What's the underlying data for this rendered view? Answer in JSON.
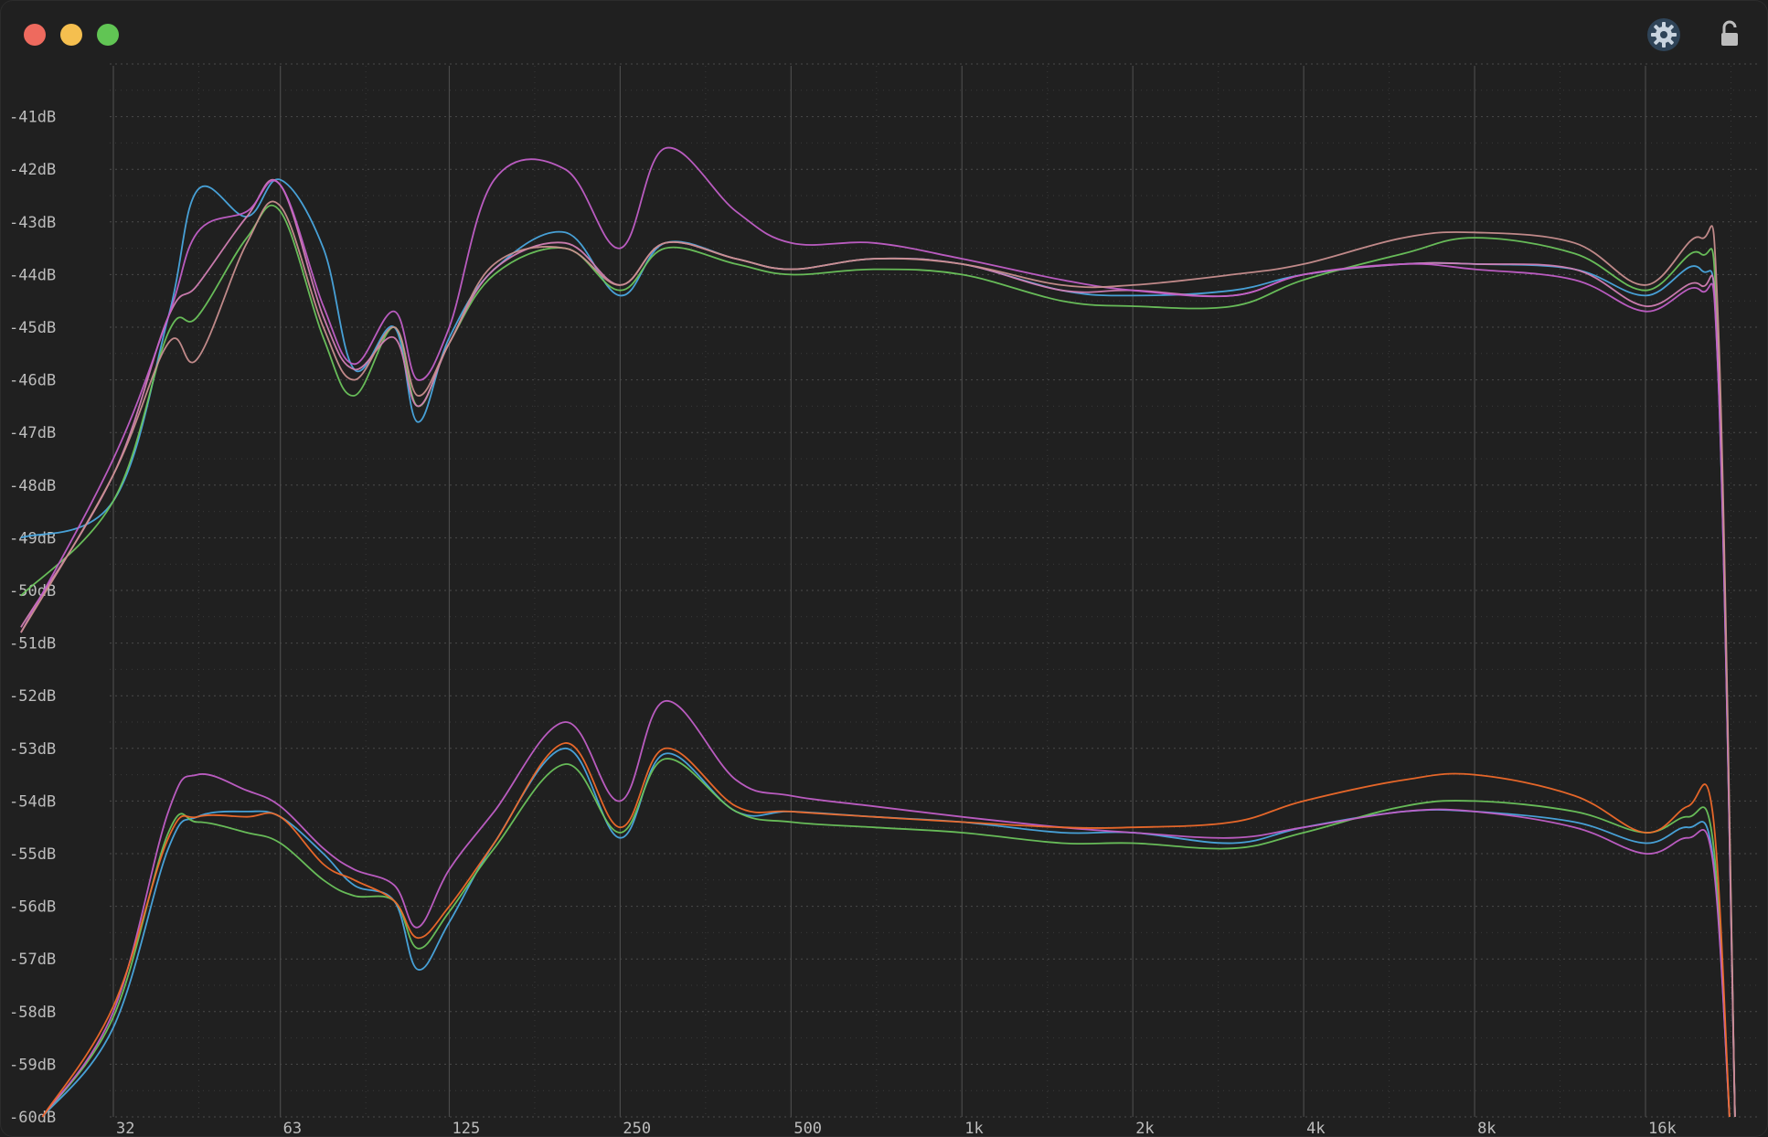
{
  "window": {
    "controls": [
      "close",
      "minimize",
      "maximize"
    ],
    "icons": [
      "gear-icon",
      "lock-icon"
    ]
  },
  "colors": {
    "background": "#202020",
    "grid_major": "#4a4a4a",
    "grid_minor": "#3a3a3a",
    "label": "#bdbdbd",
    "blue": "#4aa8e0",
    "green": "#6cc45c",
    "pink": "#d27fb4",
    "magenta": "#c25fc8",
    "rose": "#c98f8f",
    "orange": "#f06a2a"
  },
  "chart_data": {
    "type": "line",
    "title": "",
    "xlabel": "",
    "ylabel": "",
    "x_scale": "log",
    "xlim": [
      22,
      25000
    ],
    "ylim": [
      -60,
      -40
    ],
    "y_ticks": [
      "-41dB",
      "-42dB",
      "-43dB",
      "-44dB",
      "-45dB",
      "-46dB",
      "-47dB",
      "-48dB",
      "-49dB",
      "-50dB",
      "-51dB",
      "-52dB",
      "-53dB",
      "-54dB",
      "-55dB",
      "-56dB",
      "-57dB",
      "-58dB",
      "-59dB",
      "-60dB"
    ],
    "y_tick_values": [
      -41,
      -42,
      -43,
      -44,
      -45,
      -46,
      -47,
      -48,
      -49,
      -50,
      -51,
      -52,
      -53,
      -54,
      -55,
      -56,
      -57,
      -58,
      -59,
      -60
    ],
    "x_ticks": [
      "32",
      "63",
      "125",
      "250",
      "500",
      "1k",
      "2k",
      "4k",
      "8k",
      "16k"
    ],
    "x_tick_values": [
      32,
      63,
      125,
      250,
      500,
      1000,
      2000,
      4000,
      8000,
      16000
    ],
    "grid": true,
    "series": [
      {
        "group": "upper",
        "color": "#4aa8e0",
        "x": [
          22,
          32,
          40,
          45,
          55,
          63,
          75,
          85,
          100,
          110,
          125,
          150,
          200,
          250,
          300,
          400,
          500,
          700,
          1000,
          1500,
          2000,
          3000,
          4000,
          6000,
          8000,
          12000,
          16000,
          20000,
          21500,
          23000
        ],
        "y": [
          -49.0,
          -48.3,
          -44.8,
          -42.4,
          -42.9,
          -42.2,
          -43.5,
          -45.8,
          -45.0,
          -46.8,
          -45.2,
          -43.9,
          -43.2,
          -44.4,
          -43.4,
          -43.7,
          -43.9,
          -43.7,
          -43.8,
          -44.3,
          -44.4,
          -44.3,
          -44.0,
          -43.8,
          -43.8,
          -43.9,
          -44.4,
          -43.9,
          -46.0,
          -60.0
        ]
      },
      {
        "group": "upper",
        "color": "#6cc45c",
        "x": [
          22,
          32,
          40,
          45,
          55,
          63,
          75,
          85,
          100,
          110,
          125,
          150,
          200,
          250,
          300,
          400,
          500,
          700,
          1000,
          1500,
          2000,
          3000,
          4000,
          6000,
          8000,
          12000,
          16000,
          20000,
          21500,
          23000
        ],
        "y": [
          -50.1,
          -48.3,
          -45.1,
          -44.8,
          -43.3,
          -42.8,
          -45.2,
          -46.3,
          -45.0,
          -46.5,
          -45.3,
          -44.0,
          -43.5,
          -44.3,
          -43.5,
          -43.8,
          -44.0,
          -43.9,
          -44.0,
          -44.5,
          -44.6,
          -44.6,
          -44.1,
          -43.6,
          -43.3,
          -43.6,
          -44.3,
          -43.6,
          -45.5,
          -60.0
        ]
      },
      {
        "group": "upper",
        "color": "#d27fb4",
        "x": [
          22,
          32,
          40,
          45,
          55,
          63,
          75,
          85,
          100,
          110,
          125,
          150,
          200,
          250,
          300,
          400,
          500,
          700,
          1000,
          1500,
          2000,
          3000,
          4000,
          6000,
          8000,
          12000,
          16000,
          20000,
          21500,
          23000
        ],
        "y": [
          -50.7,
          -47.8,
          -44.8,
          -44.2,
          -42.9,
          -42.3,
          -44.8,
          -45.8,
          -45.2,
          -46.5,
          -45.3,
          -43.9,
          -43.4,
          -44.2,
          -43.4,
          -43.7,
          -43.9,
          -43.7,
          -43.8,
          -44.3,
          -44.3,
          -44.4,
          -44.0,
          -43.8,
          -43.8,
          -43.9,
          -44.6,
          -44.2,
          -45.8,
          -60.0
        ]
      },
      {
        "group": "upper",
        "color": "#c25fc8",
        "x": [
          22,
          32,
          40,
          45,
          55,
          63,
          75,
          85,
          100,
          110,
          125,
          150,
          200,
          250,
          300,
          400,
          500,
          700,
          1000,
          1500,
          2000,
          3000,
          4000,
          6000,
          8000,
          12000,
          16000,
          20000,
          21500,
          23000
        ],
        "y": [
          -50.8,
          -47.5,
          -44.8,
          -43.2,
          -42.8,
          -42.3,
          -44.6,
          -45.7,
          -44.7,
          -46.0,
          -45.0,
          -42.2,
          -42.0,
          -43.5,
          -41.6,
          -42.8,
          -43.4,
          -43.4,
          -43.7,
          -44.1,
          -44.3,
          -44.4,
          -44.0,
          -43.8,
          -43.9,
          -44.1,
          -44.7,
          -44.3,
          -46.0,
          -60.0
        ]
      },
      {
        "group": "upper",
        "color": "#c98f8f",
        "x": [
          22,
          32,
          40,
          45,
          55,
          63,
          75,
          85,
          100,
          110,
          125,
          150,
          200,
          250,
          300,
          400,
          500,
          700,
          1000,
          1500,
          2000,
          3000,
          4000,
          6000,
          8000,
          12000,
          16000,
          20000,
          21500,
          23000
        ],
        "y": [
          -50.8,
          -47.8,
          -45.3,
          -45.6,
          -43.4,
          -42.7,
          -45.0,
          -46.0,
          -45.0,
          -46.3,
          -45.3,
          -43.8,
          -43.5,
          -44.2,
          -43.4,
          -43.7,
          -43.9,
          -43.7,
          -43.8,
          -44.2,
          -44.2,
          -44.0,
          -43.8,
          -43.3,
          -43.2,
          -43.4,
          -44.2,
          -43.3,
          -45.0,
          -60.0
        ]
      },
      {
        "group": "lower",
        "color": "#4aa8e0",
        "x": [
          24,
          32,
          40,
          45,
          55,
          63,
          75,
          85,
          100,
          110,
          125,
          150,
          200,
          250,
          300,
          400,
          500,
          700,
          1000,
          1500,
          2000,
          3000,
          4000,
          6000,
          8000,
          12000,
          16000,
          19000,
          21000,
          22500
        ],
        "y": [
          -60.0,
          -58.3,
          -54.9,
          -54.3,
          -54.2,
          -54.3,
          -55.0,
          -55.6,
          -55.9,
          -57.2,
          -56.3,
          -54.8,
          -53.0,
          -54.7,
          -53.1,
          -54.2,
          -54.2,
          -54.3,
          -54.4,
          -54.6,
          -54.6,
          -54.8,
          -54.5,
          -54.2,
          -54.2,
          -54.4,
          -54.8,
          -54.5,
          -55.0,
          -60.0
        ]
      },
      {
        "group": "lower",
        "color": "#6cc45c",
        "x": [
          24,
          32,
          40,
          45,
          55,
          63,
          75,
          85,
          100,
          110,
          125,
          150,
          200,
          250,
          300,
          400,
          500,
          700,
          1000,
          1500,
          2000,
          3000,
          4000,
          6000,
          8000,
          12000,
          16000,
          19000,
          21000,
          22500
        ],
        "y": [
          -60.0,
          -58.1,
          -54.6,
          -54.4,
          -54.6,
          -54.8,
          -55.5,
          -55.8,
          -55.9,
          -56.8,
          -56.1,
          -54.9,
          -53.3,
          -54.6,
          -53.2,
          -54.2,
          -54.4,
          -54.5,
          -54.6,
          -54.8,
          -54.8,
          -54.9,
          -54.6,
          -54.1,
          -54.0,
          -54.2,
          -54.6,
          -54.3,
          -54.7,
          -60.0
        ]
      },
      {
        "group": "lower",
        "color": "#c25fc8",
        "x": [
          24,
          32,
          40,
          45,
          55,
          63,
          75,
          85,
          100,
          110,
          125,
          150,
          200,
          250,
          300,
          400,
          500,
          700,
          1000,
          1500,
          2000,
          3000,
          4000,
          6000,
          8000,
          12000,
          16000,
          19000,
          21000,
          22500
        ],
        "y": [
          -60.0,
          -58.0,
          -54.2,
          -53.5,
          -53.8,
          -54.1,
          -54.9,
          -55.3,
          -55.6,
          -56.4,
          -55.3,
          -54.2,
          -52.5,
          -54.0,
          -52.1,
          -53.6,
          -53.9,
          -54.1,
          -54.3,
          -54.5,
          -54.6,
          -54.7,
          -54.5,
          -54.2,
          -54.2,
          -54.5,
          -55.0,
          -54.7,
          -55.1,
          -60.0
        ]
      },
      {
        "group": "lower",
        "color": "#f06a2a",
        "x": [
          24,
          32,
          40,
          45,
          55,
          63,
          75,
          85,
          100,
          110,
          125,
          150,
          200,
          250,
          300,
          400,
          500,
          700,
          1000,
          1500,
          2000,
          3000,
          4000,
          6000,
          8000,
          12000,
          16000,
          19000,
          21000,
          22500
        ],
        "y": [
          -60.0,
          -57.9,
          -54.7,
          -54.3,
          -54.3,
          -54.3,
          -55.2,
          -55.5,
          -55.9,
          -56.6,
          -56.0,
          -54.8,
          -52.9,
          -54.5,
          -53.0,
          -54.1,
          -54.2,
          -54.3,
          -54.4,
          -54.5,
          -54.5,
          -54.4,
          -54.0,
          -53.6,
          -53.5,
          -53.9,
          -54.6,
          -54.1,
          -54.2,
          -60.0
        ]
      }
    ]
  }
}
